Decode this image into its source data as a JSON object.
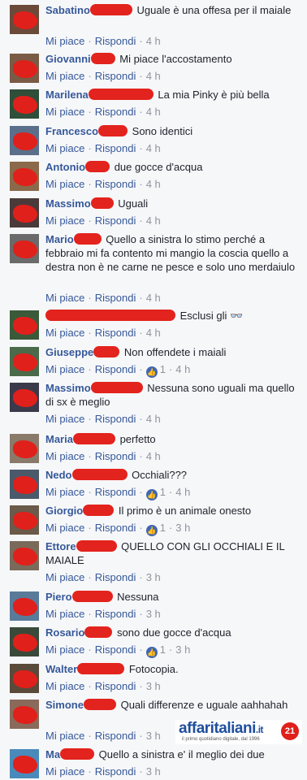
{
  "comments": [
    {
      "name": "Sabatino",
      "text": "Uguale è una offesa per il maiale",
      "like": "Mi piace",
      "reply": "Rispondi",
      "time": "4 h",
      "avatar_color": "#6b4a3a"
    },
    {
      "name": "Giovanni",
      "text": "Mi piace l'accostamento",
      "like": "Mi piace",
      "reply": "Rispondi",
      "time": "4 h",
      "avatar_color": "#7a5b45"
    },
    {
      "name": "Marilena",
      "text": "La mia Pinky è più bella",
      "like": "Mi piace",
      "reply": "Rispondi",
      "time": "4 h",
      "avatar_color": "#2f4f3a"
    },
    {
      "name": "Francesco",
      "text": "Sono identici",
      "like": "Mi piace",
      "reply": "Rispondi",
      "time": "4 h",
      "avatar_color": "#5b6f8a"
    },
    {
      "name": "Antonio",
      "text": "due gocce d'acqua",
      "like": "Mi piace",
      "reply": "Rispondi",
      "time": "4 h",
      "avatar_color": "#8a6a4a"
    },
    {
      "name": "Massimo",
      "text": "Uguali",
      "like": "Mi piace",
      "reply": "Rispondi",
      "time": "4 h",
      "avatar_color": "#4a3a3a"
    },
    {
      "name": "Mario",
      "text": "Quello a sinistra lo stimo perché a febbraio mi fa contento mi mangio la coscia quello a destra non è ne carne ne pesce e solo uno merdaiulo",
      "like": "Mi piace",
      "reply": "Rispondi",
      "time": "4 h",
      "avatar_color": "#6a6a6a"
    },
    {
      "name": "",
      "text": "Esclusi gli 👓",
      "like": "Mi piace",
      "reply": "Rispondi",
      "time": "4 h",
      "avatar_color": "#3a5a3a"
    },
    {
      "name": "Giuseppe",
      "text": "Non offendete i maiali",
      "like": "Mi piace",
      "reply": "Rispondi",
      "likes_count": "1",
      "time": "4 h",
      "avatar_color": "#4a6a4a"
    },
    {
      "name": "Massimo",
      "text": "Nessuna sono uguali ma quello di sx è meglio",
      "like": "Mi piace",
      "reply": "Rispondi",
      "time": "4 h",
      "avatar_color": "#3a3a4a"
    },
    {
      "name": "Maria",
      "text": "perfetto",
      "like": "Mi piace",
      "reply": "Rispondi",
      "time": "4 h",
      "avatar_color": "#8a7a6a"
    },
    {
      "name": "Nedo",
      "text": "Occhiali???",
      "like": "Mi piace",
      "reply": "Rispondi",
      "likes_count": "1",
      "time": "4 h",
      "avatar_color": "#4a5a6a"
    },
    {
      "name": "Giorgio",
      "text": "Il primo è un animale onesto",
      "like": "Mi piace",
      "reply": "Rispondi",
      "likes_count": "1",
      "time": "3 h",
      "avatar_color": "#6a5a4a"
    },
    {
      "name": "Ettore",
      "text": "QUELLO CON GLI OCCHIALI E IL MAIALE",
      "like": "Mi piace",
      "reply": "Rispondi",
      "time": "3 h",
      "avatar_color": "#7a6a5a"
    },
    {
      "name": "Piero",
      "text": "Nessuna",
      "like": "Mi piace",
      "reply": "Rispondi",
      "time": "3 h",
      "avatar_color": "#5a7a9a"
    },
    {
      "name": "Rosario",
      "text": "sono due gocce d'acqua",
      "like": "Mi piace",
      "reply": "Rispondi",
      "likes_count": "1",
      "time": "3 h",
      "avatar_color": "#3a4a3a"
    },
    {
      "name": "Walter",
      "text": "Fotocopia.",
      "like": "Mi piace",
      "reply": "Rispondi",
      "time": "3 h",
      "avatar_color": "#5a4a3a"
    },
    {
      "name": "Simone",
      "text": "Quali differenze e uguale aahhahah",
      "like": "Mi piace",
      "reply": "Rispondi",
      "time": "3 h",
      "avatar_color": "#8a6a5a"
    },
    {
      "name": "Ma",
      "text": "Quello a sinistra e' il meglio dei due",
      "like": "Mi piace",
      "reply": "Rispondi",
      "time": "3 h",
      "avatar_color": "#4a8aba"
    }
  ],
  "logo": {
    "name": "affaritaliani",
    "tld": ".it",
    "tagline": "il primo quotidiano digitale, dal 1996",
    "badge": "21"
  }
}
